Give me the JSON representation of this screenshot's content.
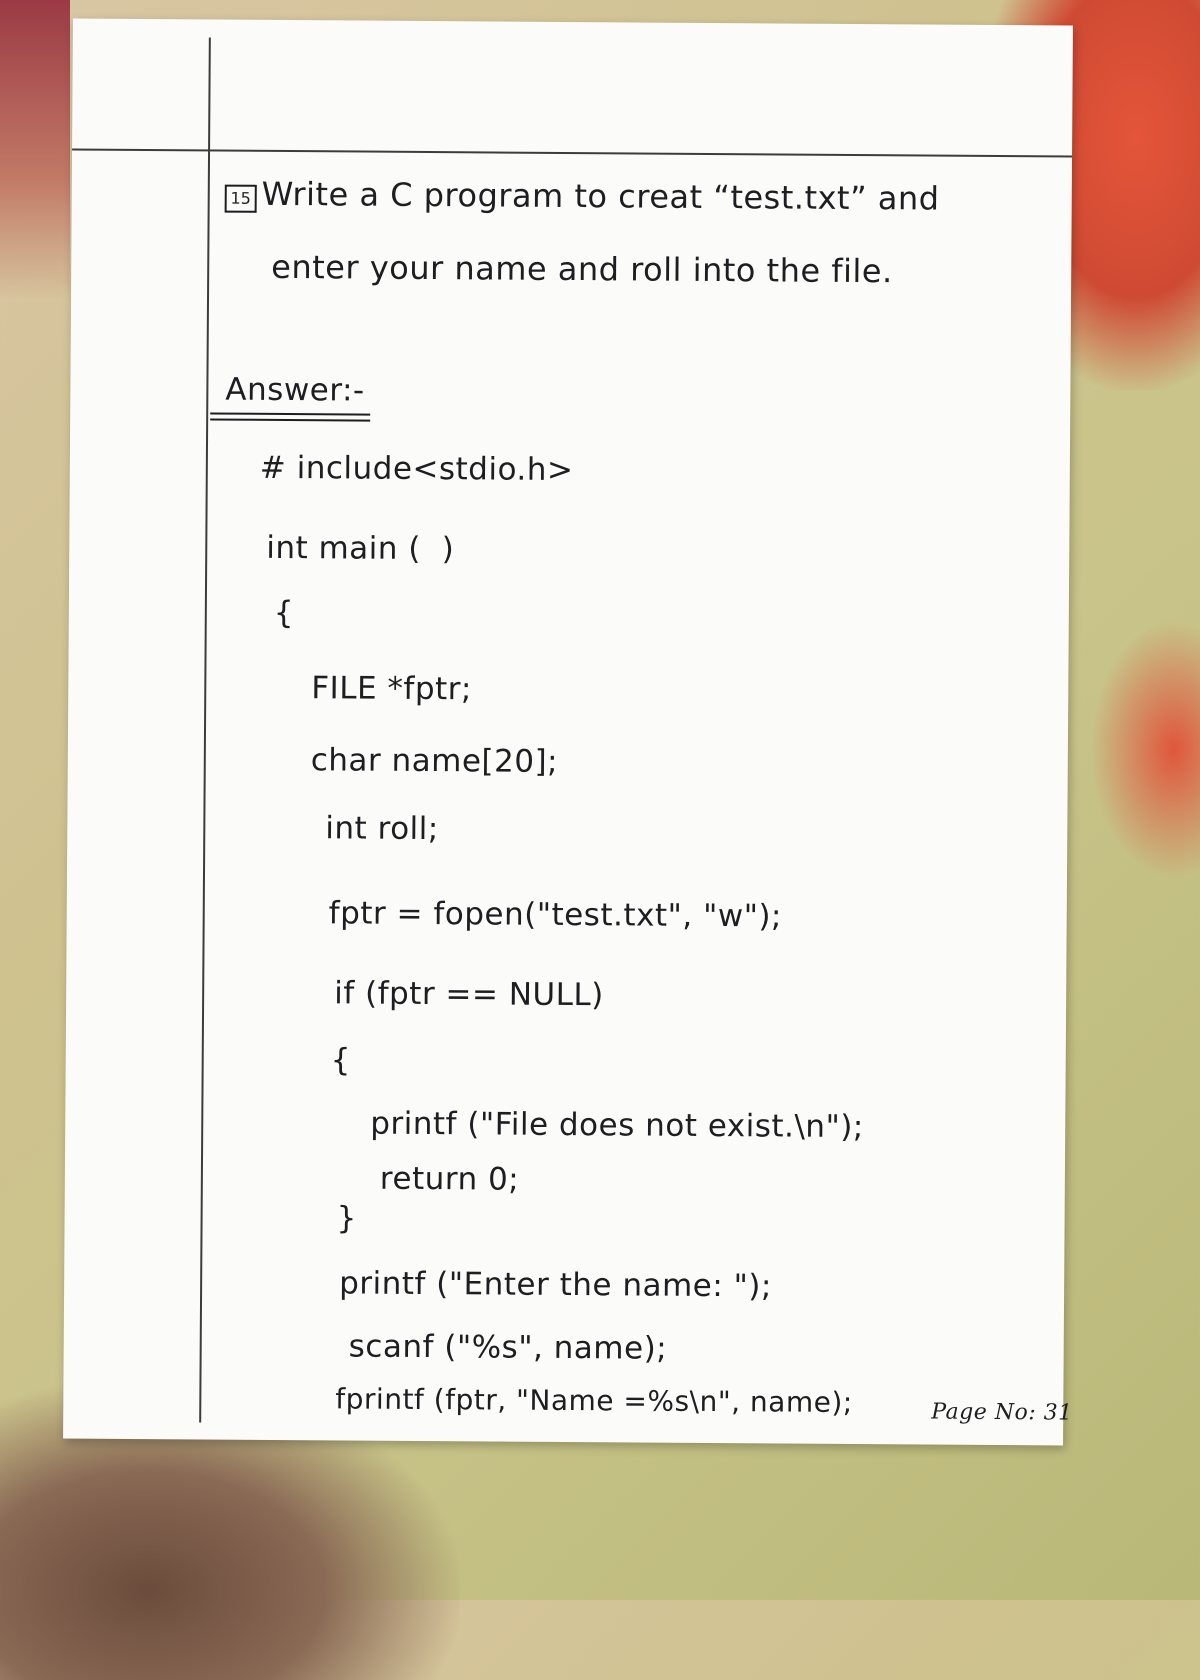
{
  "question": {
    "number": "15",
    "line1": "Write a C program to creat “test.txt” and",
    "line2": "enter your name and roll into the file."
  },
  "answer_label": "Answer:-",
  "code_lines": [
    "# include<stdio.h>",
    "int main (  )",
    "{",
    "FILE *fptr;",
    "char name[20];",
    "int roll;",
    "fptr = fopen(\"test.txt\", \"w\");",
    "if (fptr == NULL)",
    "{",
    "printf (\"File does not exist.\\n\");",
    "return 0;",
    "}",
    "printf (\"Enter the name: \");",
    "scanf (\"%s\", name);",
    "fprintf (fptr, \"Name =%s\\n\", name);"
  ],
  "page_number": "Page No: 31"
}
